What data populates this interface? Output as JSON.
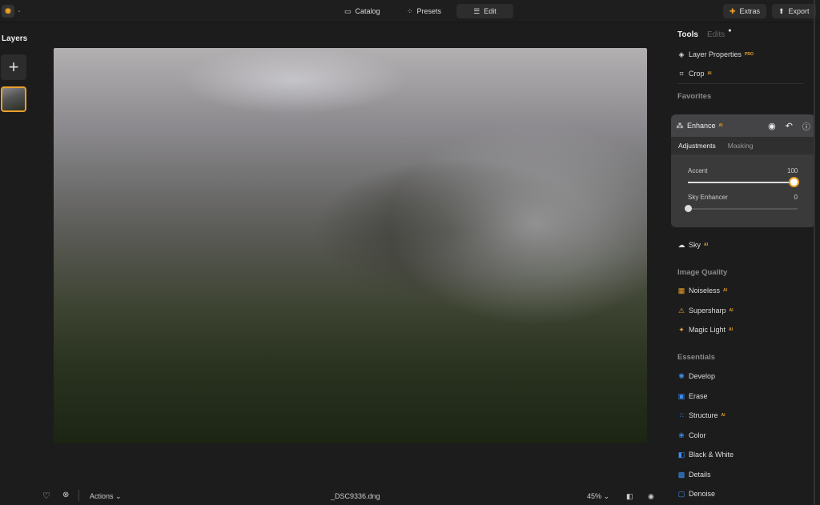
{
  "topbar": {
    "catalog": "Catalog",
    "presets": "Presets",
    "edit": "Edit",
    "extras": "Extras",
    "export": "Export"
  },
  "layers": {
    "title": "Layers",
    "add": "+"
  },
  "tools": {
    "tab_tools": "Tools",
    "tab_edits": "Edits",
    "layer_properties": "Layer Properties",
    "pro_badge": "PRO",
    "crop": "Crop",
    "ai_badge": "AI",
    "favorites": "Favorites"
  },
  "enhance": {
    "title": "Enhance",
    "tab_adjustments": "Adjustments",
    "tab_masking": "Masking",
    "sliders": [
      {
        "label": "Accent",
        "value": "100",
        "fraction": 1.0
      },
      {
        "label": "Sky Enhancer",
        "value": "0",
        "fraction": 0.0
      }
    ]
  },
  "sky": "Sky",
  "image_quality": {
    "title": "Image Quality",
    "items": [
      "Noiseless",
      "Supersharp",
      "Magic Light"
    ]
  },
  "essentials": {
    "title": "Essentials",
    "items": [
      "Develop",
      "Erase",
      "Structure",
      "Color",
      "Black & White",
      "Details",
      "Denoise"
    ]
  },
  "bottom": {
    "actions": "Actions",
    "filename": "_DSC9336.dng",
    "zoom": "45%"
  },
  "colors": {
    "accent": "#e8a02a",
    "essentials_icon": "#3b8ff0"
  }
}
